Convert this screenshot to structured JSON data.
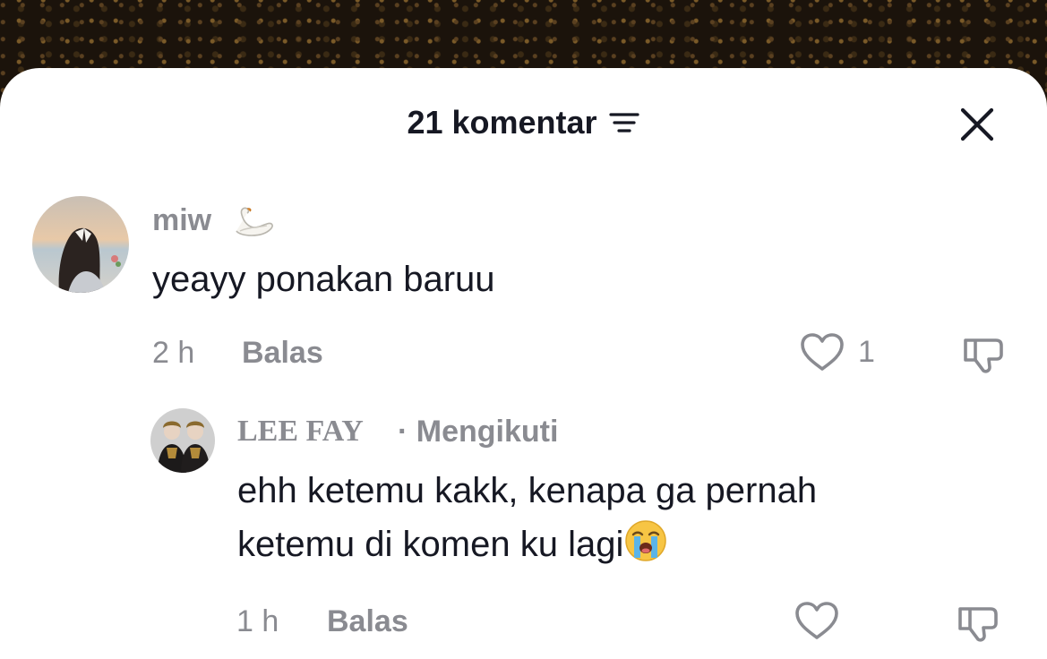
{
  "header": {
    "title": "21 komentar",
    "filter_icon": "filter-icon",
    "close_icon": "close-icon"
  },
  "comments": [
    {
      "username": "miw",
      "username_emoji": "swan",
      "text": "yeayy ponakan baruu",
      "time": "2 h",
      "reply_label": "Balas",
      "like_count": "1"
    },
    {
      "username": "LEE FAY",
      "separator": "·",
      "following_label": "Mengikuti",
      "text": "ehh ketemu kakk, kenapa ga pernah ketemu di komen ku lagi",
      "text_emoji": "loudly-crying-face",
      "time": "1 h",
      "reply_label": "Balas",
      "like_count": ""
    }
  ],
  "colors": {
    "text_primary": "#161823",
    "text_secondary": "#8a8b91",
    "sheet_bg": "#ffffff"
  }
}
